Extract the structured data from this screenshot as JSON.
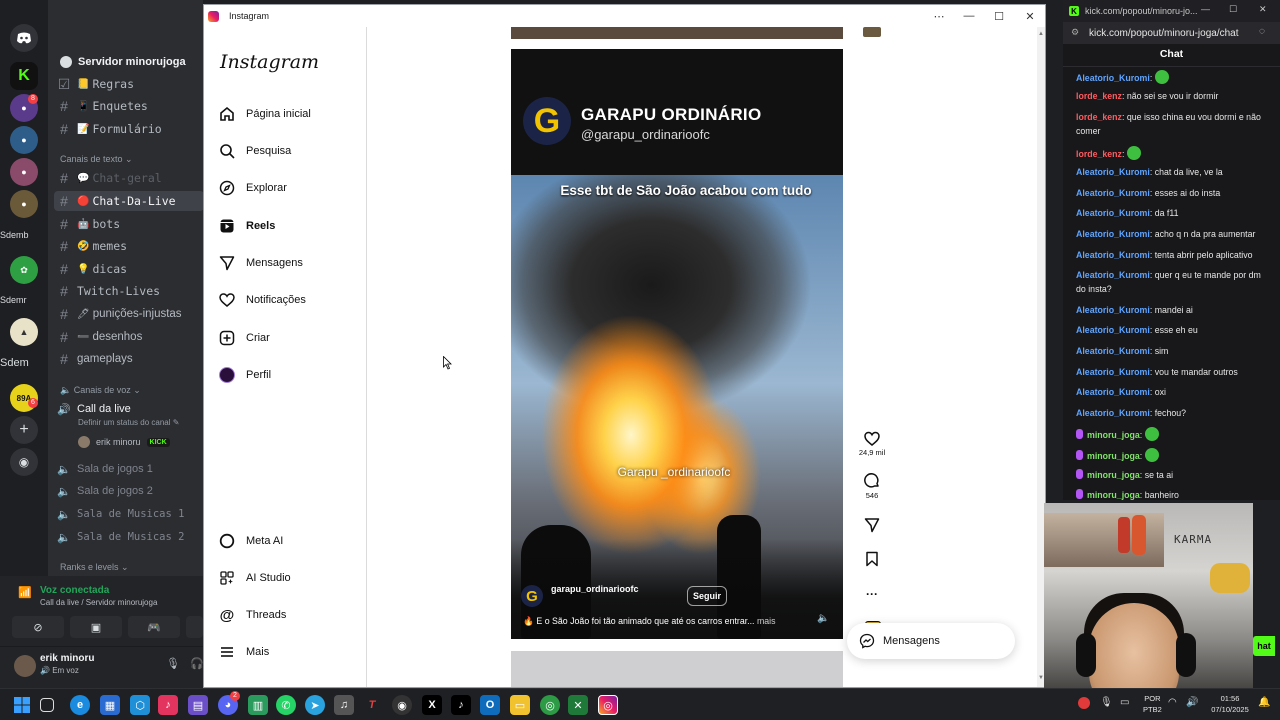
{
  "discord": {
    "server_name": "Servidor minorujoga",
    "rail_labels": [
      "Sdemb",
      "Sdemr",
      "Sdem"
    ],
    "rail_badges": [
      "8",
      "6"
    ],
    "channels": [
      {
        "emoji": "📒",
        "name": "Regras"
      },
      {
        "emoji": "📱",
        "name": "Enquetes"
      },
      {
        "emoji": "📝",
        "name": "Formulário"
      }
    ],
    "category_text": "Canais de texto",
    "text_channels": [
      {
        "emoji": "💬",
        "name": "Chat-geral",
        "state": "muted"
      },
      {
        "emoji": "🔴",
        "name": "Chat-Da-Live",
        "state": "selected"
      },
      {
        "emoji": "🤖",
        "name": "bots",
        "state": ""
      },
      {
        "emoji": "🤣",
        "name": "memes",
        "state": ""
      },
      {
        "emoji": "💡",
        "name": "dicas",
        "state": ""
      },
      {
        "emoji": "",
        "name": "Twitch-Lives",
        "state": ""
      },
      {
        "emoji": "🖊",
        "name": "punições-injustas",
        "state": ""
      },
      {
        "emoji": "➖",
        "name": "desenhos",
        "state": ""
      },
      {
        "emoji": "",
        "name": "gameplays",
        "state": ""
      }
    ],
    "category_voice": "Canais de voz",
    "voice_live": "Call da live",
    "voice_live_status": "Definir um status do canal",
    "voice_user": "erik minoru",
    "voice_user_badge": "KICK",
    "voice_channels": [
      "Sala de jogos 1",
      "Sala de jogos 2",
      "Sala de Musicas 1",
      "Sala de Musicas 2"
    ],
    "category_ranks": "Ranks e levels",
    "voice_connected": "Voz conectada",
    "voice_connected_sub": "Call da live / Servidor minorujoga",
    "user_name": "erik minoru",
    "user_status": "Em voz"
  },
  "instagram": {
    "window_title": "Instagram",
    "logo": "Instagram",
    "nav": [
      {
        "icon": "home-icon",
        "label": "Página inicial"
      },
      {
        "icon": "search-icon",
        "label": "Pesquisa"
      },
      {
        "icon": "explore-icon",
        "label": "Explorar"
      },
      {
        "icon": "reels-icon",
        "label": "Reels"
      },
      {
        "icon": "messages-icon",
        "label": "Mensagens"
      },
      {
        "icon": "heart-icon",
        "label": "Notificações"
      },
      {
        "icon": "create-icon",
        "label": "Criar"
      },
      {
        "icon": "profile-icon",
        "label": "Perfil"
      }
    ],
    "nav_bottom": [
      {
        "icon": "meta-ai-icon",
        "label": "Meta AI"
      },
      {
        "icon": "ai-studio-icon",
        "label": "AI Studio"
      },
      {
        "icon": "threads-icon",
        "label": "Threads"
      },
      {
        "icon": "menu-icon",
        "label": "Mais"
      }
    ],
    "reel": {
      "header_name": "GARAPU ORDINÁRIO",
      "header_handle": "@garapu_ordinarioofc",
      "caption_top": "Esse tbt de São João acabou com tudo",
      "watermark": "Garapu _ordinarioofc",
      "author": "garapu_ordinarioofc",
      "follow_label": "Seguir",
      "caption": "🔥 E o São João foi tão animado que até os carros entrar...",
      "more": "mais"
    },
    "likes": "24,9 mil",
    "comments": "546",
    "messages_pill": "Mensagens"
  },
  "kick": {
    "tab_title": "kick.com/popout/minoru-jo...",
    "url": "kick.com/popout/minoru-joga/chat",
    "chat_title": "Chat",
    "messages": [
      {
        "user": "Aleatorio_Kuromi",
        "cls": "u-a",
        "text": "",
        "emote": true,
        "badge": false
      },
      {
        "user": "lorde_kenz",
        "cls": "u-l",
        "text": "não sei se vou ir dormir",
        "emote": false,
        "badge": false
      },
      {
        "user": "lorde_kenz",
        "cls": "u-l",
        "text": "que isso china eu vou dormi e não comer",
        "emote": false,
        "badge": false
      },
      {
        "user": "lorde_kenz",
        "cls": "u-l",
        "text": "",
        "emote": true,
        "badge": false
      },
      {
        "user": "Aleatorio_Kuromi",
        "cls": "u-a",
        "text": "chat da live, ve la",
        "emote": false,
        "badge": false
      },
      {
        "user": "Aleatorio_Kuromi",
        "cls": "u-a",
        "text": "esses ai do insta",
        "emote": false,
        "badge": false
      },
      {
        "user": "Aleatorio_Kuromi",
        "cls": "u-a",
        "text": "da f11",
        "emote": false,
        "badge": false
      },
      {
        "user": "Aleatorio_Kuromi",
        "cls": "u-a",
        "text": "acho q n da pra aumentar",
        "emote": false,
        "badge": false
      },
      {
        "user": "Aleatorio_Kuromi",
        "cls": "u-a",
        "text": "tenta abrir pelo aplicativo",
        "emote": false,
        "badge": false
      },
      {
        "user": "Aleatorio_Kuromi",
        "cls": "u-a",
        "text": "quer q eu te mande por dm do insta?",
        "emote": false,
        "badge": false
      },
      {
        "user": "Aleatorio_Kuromi",
        "cls": "u-a",
        "text": "mandei ai",
        "emote": false,
        "badge": false
      },
      {
        "user": "Aleatorio_Kuromi",
        "cls": "u-a",
        "text": "esse eh eu",
        "emote": false,
        "badge": false
      },
      {
        "user": "Aleatorio_Kuromi",
        "cls": "u-a",
        "text": "sim",
        "emote": false,
        "badge": false
      },
      {
        "user": "Aleatorio_Kuromi",
        "cls": "u-a",
        "text": "vou te mandar outros",
        "emote": false,
        "badge": false
      },
      {
        "user": "Aleatorio_Kuromi",
        "cls": "u-a",
        "text": "oxi",
        "emote": false,
        "badge": false
      },
      {
        "user": "Aleatorio_Kuromi",
        "cls": "u-a",
        "text": "fechou?",
        "emote": false,
        "badge": false
      },
      {
        "user": "minoru_joga",
        "cls": "u-m",
        "text": "",
        "emote": true,
        "badge": true
      },
      {
        "user": "minoru_joga",
        "cls": "u-m",
        "text": "",
        "emote": true,
        "badge": true
      },
      {
        "user": "minoru_joga",
        "cls": "u-m",
        "text": "se ta ai",
        "emote": false,
        "badge": true
      },
      {
        "user": "minoru_joga",
        "cls": "u-m",
        "text": "banheiro",
        "emote": false,
        "badge": true
      }
    ],
    "send_fragment": "hat"
  },
  "webcam_text": "KARMA",
  "taskbar": {
    "lang_top": "POR",
    "lang_bottom": "PTB2",
    "time": "01:56",
    "date": "07/10/2025",
    "badge": "2"
  },
  "colors": {
    "discord_blurple": "#5865f2",
    "kick_green": "#53fc18",
    "ig_white": "#ffffff"
  }
}
